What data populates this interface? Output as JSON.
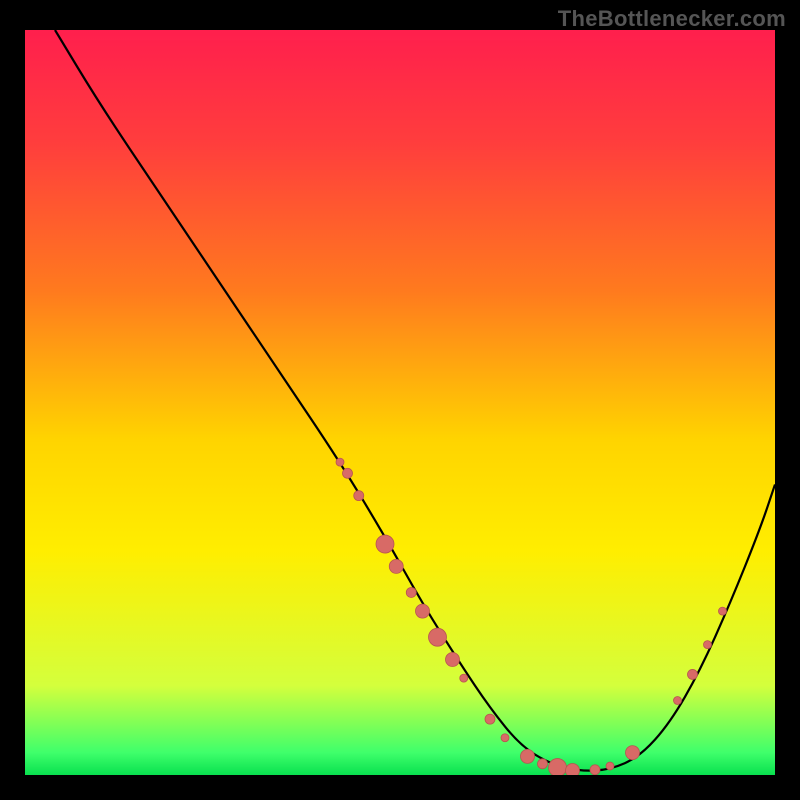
{
  "attribution": "TheBottlenecker.com",
  "colors": {
    "bg": "#000000",
    "attribution_text": "#555555",
    "gradient_stops": [
      {
        "offset": 0.0,
        "color": "#ff1f4d"
      },
      {
        "offset": 0.15,
        "color": "#ff3d3d"
      },
      {
        "offset": 0.35,
        "color": "#ff7a1e"
      },
      {
        "offset": 0.55,
        "color": "#ffd400"
      },
      {
        "offset": 0.7,
        "color": "#ffee00"
      },
      {
        "offset": 0.88,
        "color": "#d4ff3c"
      },
      {
        "offset": 0.97,
        "color": "#3fff6b"
      },
      {
        "offset": 1.0,
        "color": "#09e04f"
      }
    ],
    "curve": "#000000",
    "marker_fill": "#d86a66",
    "marker_stroke": "#b85450"
  },
  "chart_data": {
    "type": "line",
    "title": "",
    "xlabel": "",
    "ylabel": "",
    "xlim": [
      0,
      100
    ],
    "ylim": [
      0,
      100
    ],
    "series": [
      {
        "name": "bottleneck-curve",
        "x": [
          4,
          10,
          18,
          26,
          34,
          42,
          48,
          53,
          58,
          62,
          66,
          70,
          74,
          78,
          82,
          86,
          90,
          94,
          98,
          100
        ],
        "y": [
          100,
          90,
          78,
          66,
          54,
          42,
          32,
          23,
          15,
          9,
          4,
          1.5,
          0.5,
          0.7,
          2.5,
          7,
          14,
          23,
          33,
          39
        ]
      }
    ],
    "markers": [
      {
        "x": 42.0,
        "y": 42.0,
        "r": 4
      },
      {
        "x": 43.0,
        "y": 40.5,
        "r": 5
      },
      {
        "x": 44.5,
        "y": 37.5,
        "r": 5
      },
      {
        "x": 48.0,
        "y": 31.0,
        "r": 9
      },
      {
        "x": 49.5,
        "y": 28.0,
        "r": 7
      },
      {
        "x": 51.5,
        "y": 24.5,
        "r": 5
      },
      {
        "x": 53.0,
        "y": 22.0,
        "r": 7
      },
      {
        "x": 55.0,
        "y": 18.5,
        "r": 9
      },
      {
        "x": 57.0,
        "y": 15.5,
        "r": 7
      },
      {
        "x": 58.5,
        "y": 13.0,
        "r": 4
      },
      {
        "x": 62.0,
        "y": 7.5,
        "r": 5
      },
      {
        "x": 64.0,
        "y": 5.0,
        "r": 4
      },
      {
        "x": 67.0,
        "y": 2.5,
        "r": 7
      },
      {
        "x": 69.0,
        "y": 1.5,
        "r": 5
      },
      {
        "x": 71.0,
        "y": 1.0,
        "r": 9
      },
      {
        "x": 73.0,
        "y": 0.6,
        "r": 7
      },
      {
        "x": 76.0,
        "y": 0.7,
        "r": 5
      },
      {
        "x": 78.0,
        "y": 1.2,
        "r": 4
      },
      {
        "x": 81.0,
        "y": 3.0,
        "r": 7
      },
      {
        "x": 87.0,
        "y": 10.0,
        "r": 4
      },
      {
        "x": 89.0,
        "y": 13.5,
        "r": 5
      },
      {
        "x": 91.0,
        "y": 17.5,
        "r": 4
      },
      {
        "x": 93.0,
        "y": 22.0,
        "r": 4
      }
    ]
  }
}
